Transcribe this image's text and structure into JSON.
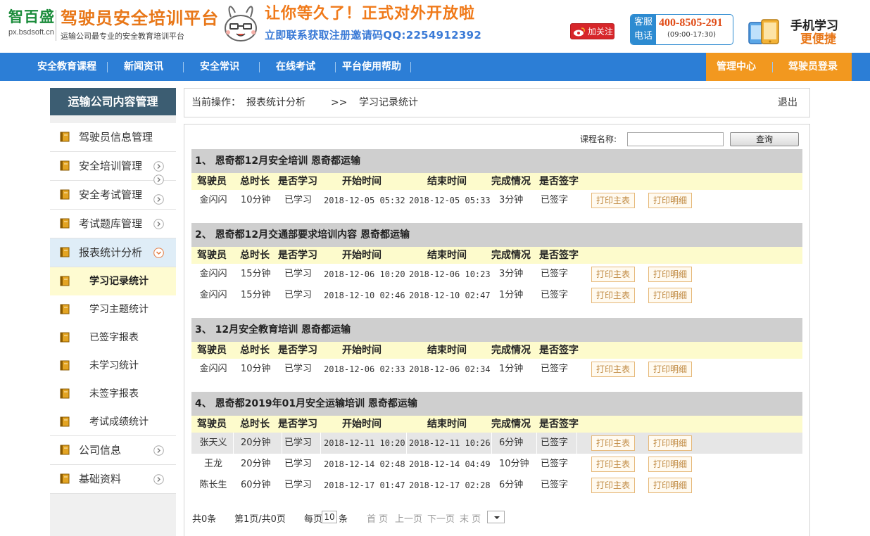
{
  "header": {
    "logo_name": "智百盛",
    "logo_url": "px.bsdsoft.cn",
    "platform_title": "驾驶员安全培训平台",
    "platform_subtitle": "运输公司最专业的安全教育培训平台",
    "promo_main": "让你等久了！正式对外开放啦",
    "promo_sub": "立即联系获取注册邀请码QQ:2254912392",
    "weibo_label": "加关注",
    "hotline_label": "客服电话",
    "hotline_number": "400-8505-291",
    "hotline_hours": "(09:00-17:30)",
    "mobile_title": "手机学习",
    "mobile_sub": "更便捷"
  },
  "nav": {
    "items": [
      "安全教育课程",
      "新闻资讯",
      "安全常识",
      "在线考试",
      "平台使用帮助"
    ],
    "right_items": [
      "管理中心",
      "驾驶员登录"
    ]
  },
  "sidebar": {
    "title": "运输公司内容管理",
    "items": [
      {
        "label": "驾驶员信息管理"
      },
      {
        "label": "安全培训管理"
      },
      {
        "label": "安全考试管理"
      },
      {
        "label": "考试题库管理"
      },
      {
        "label": "报表统计分析"
      }
    ],
    "sub_items": [
      "学习记录统计",
      "学习主题统计",
      "已签字报表",
      "未学习统计",
      "未签字报表",
      "考试成绩统计"
    ],
    "bottom_items": [
      {
        "label": "公司信息"
      },
      {
        "label": "基础资料"
      }
    ]
  },
  "breadcrumb": {
    "prefix": "当前操作：",
    "level1": "报表统计分析",
    "separator": ">>",
    "level2": "学习记录统计",
    "logout": "退出"
  },
  "search": {
    "label": "课程名称:",
    "value": "",
    "button": "查询"
  },
  "table_headers": [
    "驾驶员",
    "总时长",
    "是否学习",
    "开始时间",
    "结束时间",
    "完成情况",
    "是否签字"
  ],
  "print_main_label": "打印主表",
  "print_detail_label": "打印明细",
  "groups": [
    {
      "title": "1、 恩奇都12月安全培训   恩奇都运输",
      "rows": [
        {
          "driver": "金闪闪",
          "duration": "10分钟",
          "studied": "已学习",
          "start": "2018-12-05 05:32",
          "end": "2018-12-05 05:33",
          "completion": "3分钟",
          "signed": "已签字"
        }
      ]
    },
    {
      "title": "2、 恩奇都12月交通部要求培训内容   恩奇都运输",
      "rows": [
        {
          "driver": "金闪闪",
          "duration": "15分钟",
          "studied": "已学习",
          "start": "2018-12-06 10:20",
          "end": "2018-12-06 10:23",
          "completion": "3分钟",
          "signed": "已签字"
        },
        {
          "driver": "金闪闪",
          "duration": "15分钟",
          "studied": "已学习",
          "start": "2018-12-10 02:46",
          "end": "2018-12-10 02:47",
          "completion": "1分钟",
          "signed": "已签字"
        }
      ]
    },
    {
      "title": "3、 12月安全教育培训   恩奇都运输",
      "rows": [
        {
          "driver": "金闪闪",
          "duration": "10分钟",
          "studied": "已学习",
          "start": "2018-12-06 02:33",
          "end": "2018-12-06 02:34",
          "completion": "1分钟",
          "signed": "已签字"
        }
      ]
    },
    {
      "title": "4、 恩奇都2019年01月安全运输培训   恩奇都运输",
      "rows": [
        {
          "driver": "张天义",
          "duration": "20分钟",
          "studied": "已学习",
          "start": "2018-12-11 10:20",
          "end": "2018-12-11 10:26",
          "completion": "6分钟",
          "signed": "已签字"
        },
        {
          "driver": "王龙",
          "duration": "20分钟",
          "studied": "已学习",
          "start": "2018-12-14 02:48",
          "end": "2018-12-14 04:49",
          "completion": "10分钟",
          "signed": "已签字"
        },
        {
          "driver": "陈长生",
          "duration": "60分钟",
          "studied": "已学习",
          "start": "2018-12-17 01:47",
          "end": "2018-12-17 02:28",
          "completion": "6分钟",
          "signed": "已签字"
        }
      ]
    }
  ],
  "pager": {
    "total": "共0条",
    "page_info": "第1页/共0页",
    "per_page_prefix": "每页",
    "per_page_value": "10",
    "per_page_suffix": "条",
    "first": "首 页",
    "prev": "上一页",
    "next": "下一页",
    "last": "末 页"
  },
  "colors": {
    "nav_blue": "#2c7ed6",
    "nav_orange": "#f2981f",
    "sidebar_title": "#3c5d72",
    "group_title_bg": "#cfcfcf",
    "header_row_bg": "#fdfbcc"
  }
}
